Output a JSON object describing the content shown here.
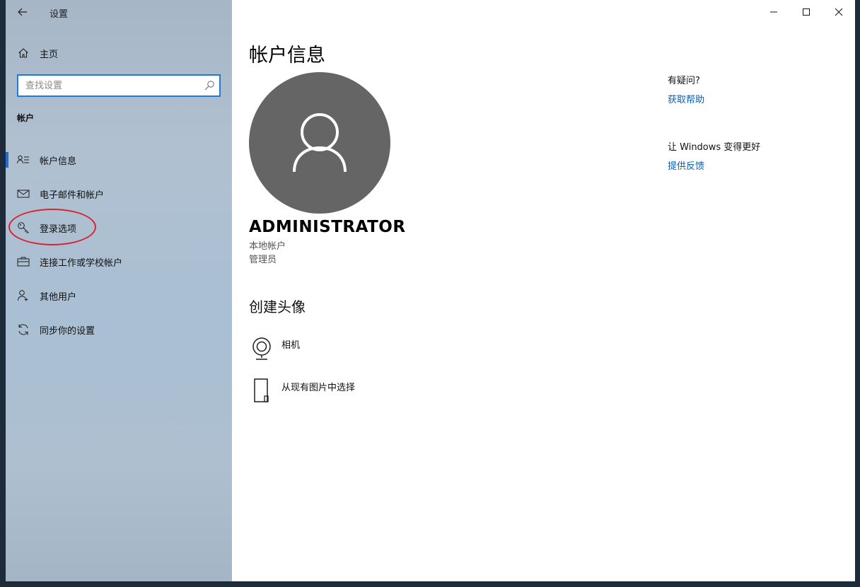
{
  "window": {
    "app_title": "设置",
    "controls": [
      "minimize-icon",
      "maximize-icon",
      "close-icon"
    ]
  },
  "sidebar": {
    "home_label": "主页",
    "search_placeholder": "查找设置",
    "section_label": "帐户",
    "items": [
      {
        "label": "帐户信息",
        "icon": "person-list-icon",
        "active": true
      },
      {
        "label": "电子邮件和帐户",
        "icon": "mail-icon",
        "active": false
      },
      {
        "label": "登录选项",
        "icon": "key-icon",
        "active": false
      },
      {
        "label": "连接工作或学校帐户",
        "icon": "briefcase-icon",
        "active": false
      },
      {
        "label": "其他用户",
        "icon": "person-add-icon",
        "active": false
      },
      {
        "label": "同步你的设置",
        "icon": "sync-icon",
        "active": false
      }
    ]
  },
  "main": {
    "title": "帐户信息",
    "user_name": "ADMINISTRATOR",
    "account_type": "本地帐户",
    "role": "管理员",
    "create_avatar_heading": "创建头像",
    "options": [
      {
        "label": "相机",
        "icon": "camera-icon"
      },
      {
        "label": "从现有图片中选择",
        "icon": "browse-file-icon"
      }
    ]
  },
  "right_panel": {
    "help_heading": "有疑问?",
    "help_link": "获取帮助",
    "feedback_heading": "让 Windows 变得更好",
    "feedback_link": "提供反馈"
  },
  "colors": {
    "accent": "#1e6fd0",
    "link": "#0a5fb4",
    "avatar_bg": "#656565",
    "annotation": "#d8262f"
  }
}
